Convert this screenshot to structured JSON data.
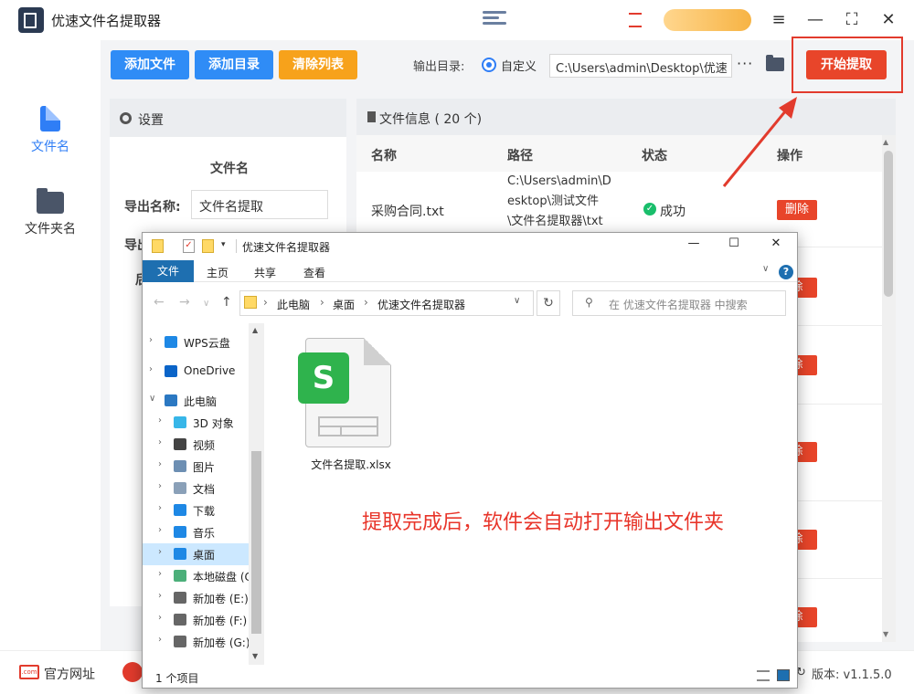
{
  "app": {
    "title": "优速文件名提取器",
    "window_controls": [
      "≡",
      "—",
      "⛶",
      "✕"
    ]
  },
  "leftnav": {
    "items": [
      {
        "label": "文件名",
        "icon": "file-icon",
        "active": true
      },
      {
        "label": "文件夹名",
        "icon": "folder-icon",
        "active": false
      }
    ]
  },
  "toolbar": {
    "add_file": "添加文件",
    "add_dir": "添加目录",
    "clear_list": "清除列表",
    "output_label": "输出目录:",
    "radio_label": "自定义",
    "output_path": "C:\\Users\\admin\\Desktop\\优速",
    "more": "···",
    "start": "开始提取"
  },
  "settings": {
    "title": "设置",
    "section": "文件名",
    "export_name_label": "导出名称:",
    "export_name_value": "文件名提取",
    "cut_label_1": "导出",
    "cut_label_2": "后"
  },
  "file_info": {
    "title": "文件信息 ( 20 个)",
    "columns": [
      "名称",
      "路径",
      "状态",
      "操作"
    ],
    "rows": [
      {
        "name": "采购合同.txt",
        "path_lines": [
          "C:\\Users\\admin\\D",
          "esktop\\测试文件",
          "\\文件名提取器\\txt"
        ],
        "status": "成功",
        "action": "删除"
      }
    ],
    "cut_delete_label": "除"
  },
  "footer": {
    "site": "官方网址",
    "site_icon_text": ".com",
    "version": "版本: v1.1.5.0"
  },
  "explorer": {
    "title": "优速文件名提取器",
    "tabs": [
      "文件",
      "主页",
      "共享",
      "查看"
    ],
    "breadcrumb": [
      "此电脑",
      "桌面",
      "优速文件名提取器"
    ],
    "search_placeholder": "在 优速文件名提取器 中搜索",
    "tree": [
      {
        "label": "WPS云盘",
        "icon": "cloud-icon",
        "color": "#1e88e5"
      },
      {
        "label": "OneDrive",
        "icon": "onedrive-icon",
        "color": "#0a64c8"
      },
      {
        "label": "此电脑",
        "icon": "pc-icon",
        "color": "#2b78c2"
      },
      {
        "label": "3D 对象",
        "icon": "cube-icon",
        "color": "#37b6e8"
      },
      {
        "label": "视频",
        "icon": "video-icon",
        "color": "#444444"
      },
      {
        "label": "图片",
        "icon": "picture-icon",
        "color": "#6d8fb3"
      },
      {
        "label": "文档",
        "icon": "document-icon",
        "color": "#8aa0b8"
      },
      {
        "label": "下载",
        "icon": "download-icon",
        "color": "#1e88e5"
      },
      {
        "label": "音乐",
        "icon": "music-icon",
        "color": "#1e88e5"
      },
      {
        "label": "桌面",
        "icon": "desktop-icon",
        "color": "#1e88e5"
      },
      {
        "label": "本地磁盘 (C",
        "icon": "drive-icon",
        "color": "#4caf7a"
      },
      {
        "label": "新加卷 (E:)",
        "icon": "drive-icon",
        "color": "#666666"
      },
      {
        "label": "新加卷 (F:)",
        "icon": "drive-icon",
        "color": "#666666"
      },
      {
        "label": "新加卷 (G:)",
        "icon": "drive-icon",
        "color": "#666666"
      }
    ],
    "file": {
      "name": "文件名提取.xlsx",
      "badge": "S"
    },
    "status": "1 个项目"
  },
  "annotation": "提取完成后，软件会自动打开输出文件夹",
  "colors": {
    "accent_blue": "#2f8cf6",
    "accent_orange": "#f7a21b",
    "danger": "#e8452a",
    "success": "#19be6b"
  }
}
